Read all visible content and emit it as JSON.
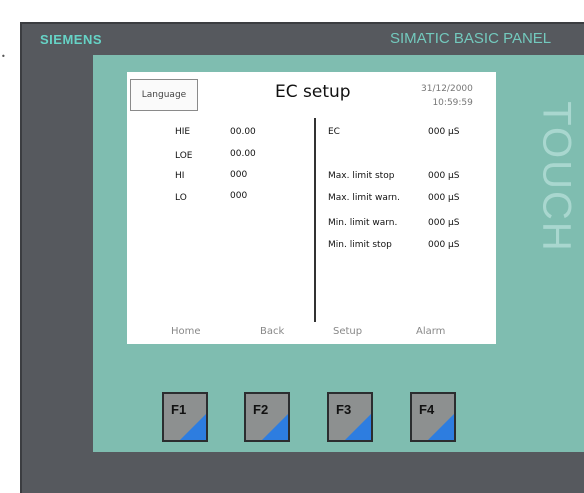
{
  "panel": {
    "brand": "SIEMENS",
    "series": "SIMATIC BASIC PANEL",
    "touch_label": "TOUCH"
  },
  "screen": {
    "language_button": "Language",
    "title": "EC setup",
    "date": "31/12/2000",
    "time": "10:59:59",
    "left_params": [
      {
        "label": "HIE",
        "value": "00.00"
      },
      {
        "label": "LOE",
        "value": "00.00"
      },
      {
        "label": "HI",
        "value": "000"
      },
      {
        "label": "LO",
        "value": "000"
      }
    ],
    "right_params": [
      {
        "label": "EC",
        "value": "000 µS"
      },
      {
        "label": "Max. limit stop",
        "value": "000 µS"
      },
      {
        "label": "Max. limit warn.",
        "value": "000 µS"
      },
      {
        "label": "Min. limit warn.",
        "value": "000 µS"
      },
      {
        "label": "Min. limit stop",
        "value": "000 µS"
      }
    ],
    "nav": [
      "Home",
      "Back",
      "Setup",
      "Alarm"
    ]
  },
  "function_keys": [
    "F1",
    "F2",
    "F3",
    "F4"
  ],
  "colors": {
    "bezel": "#7fbdb0",
    "frame": "#56595e",
    "brand": "#66d3c6",
    "key_corner": "#2d7de0"
  }
}
